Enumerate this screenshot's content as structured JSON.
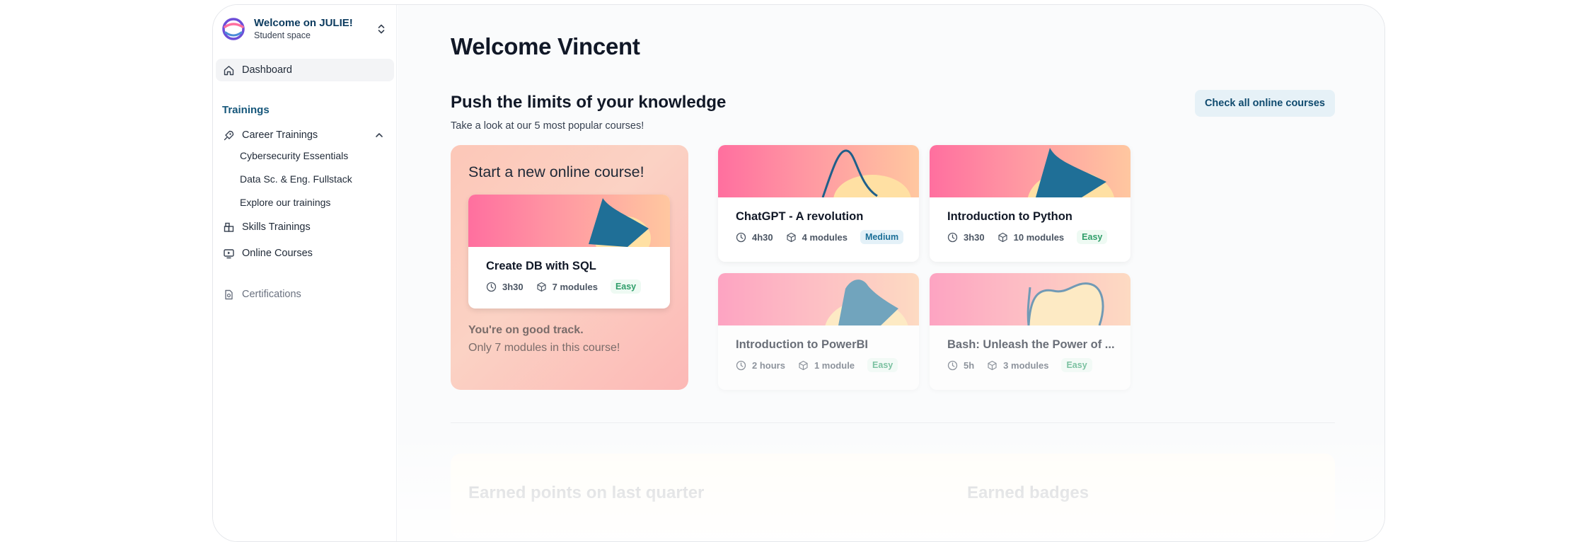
{
  "brand": {
    "title": "Welcome on JULIE!",
    "subtitle": "Student space",
    "logo_icon": "julie-logo",
    "toggle_icon": "chevrons-up-down-icon"
  },
  "sidebar": {
    "dashboard": "Dashboard",
    "section_trainings": "Trainings",
    "career_trainings": "Career Trainings",
    "career_items": [
      "Cybersecurity Essentials",
      "Data Sc. & Eng. Fullstack",
      "Explore our trainings"
    ],
    "skills_trainings": "Skills Trainings",
    "online_courses": "Online Courses",
    "certifications": "Certifications"
  },
  "main": {
    "title": "Welcome Vincent",
    "section_title": "Push the limits of your knowledge",
    "section_sub": "Take a look at our 5 most popular courses!",
    "check_all": "Check all online courses",
    "hero": {
      "title": "Start a new online course!",
      "card": {
        "title": "Create DB with SQL",
        "duration": "3h30",
        "modules": "7 modules",
        "level": "Easy"
      },
      "foot_line1": "You're on good track.",
      "foot_line2": "Only 7 modules in this course!"
    },
    "courses": [
      {
        "title": "ChatGPT - A revolution",
        "duration": "4h30",
        "modules": "4 modules",
        "level": "Medium"
      },
      {
        "title": "Introduction to Python",
        "duration": "3h30",
        "modules": "10 modules",
        "level": "Easy"
      },
      {
        "title": "Introduction to PowerBI",
        "duration": "2 hours",
        "modules": "1 module",
        "level": "Easy"
      },
      {
        "title": "Bash: Unleash the Power of ...",
        "duration": "5h",
        "modules": "3 modules",
        "level": "Easy"
      }
    ],
    "lower_left_title": "Earned points on last quarter",
    "lower_right_title": "Earned badges"
  },
  "colors": {
    "accent": "#0f4a6e",
    "banner_start": "#ff6f9f",
    "banner_end": "#ffc7a0",
    "easy": "#2f9e6a",
    "medium": "#1b6f98"
  }
}
